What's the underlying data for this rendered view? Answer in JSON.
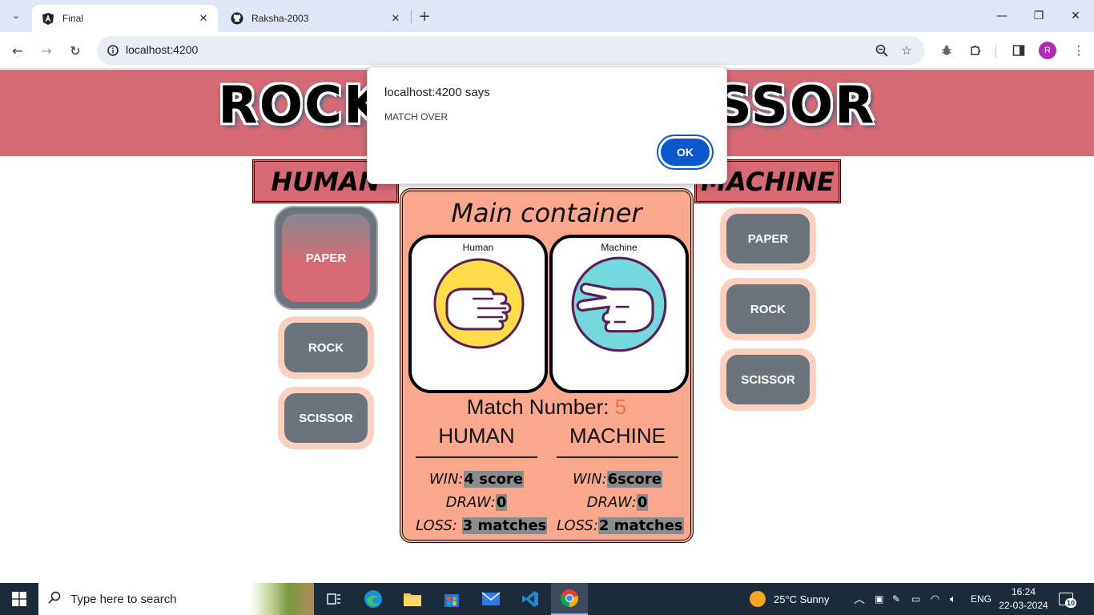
{
  "browser": {
    "tabs": [
      {
        "title": "Final",
        "icon": "angular-icon",
        "active": true
      },
      {
        "title": "Raksha-2003",
        "icon": "github-icon",
        "active": false
      }
    ],
    "url": "localhost:4200"
  },
  "page": {
    "banner_title": "ROCK PAPER SCISSOR",
    "human_header": "HUMAN",
    "machine_header": "MACHINE",
    "human_choices": [
      "PAPER",
      "ROCK",
      "SCISSOR"
    ],
    "machine_choices": [
      "PAPER",
      "ROCK",
      "SCISSOR"
    ],
    "main": {
      "title": "Main container",
      "human_card_label": "Human",
      "machine_card_label": "Machine",
      "match_label": "Match Number:",
      "match_number": "5",
      "human": {
        "title": "HUMAN",
        "win_label": "WIN:",
        "win_value": "4 score",
        "draw_label": "DRAW:",
        "draw_value": "0",
        "loss_label": "LOSS:",
        "loss_value": "3 matches"
      },
      "machine": {
        "title": "MACHINE",
        "win_label": "WIN:",
        "win_value": "6score",
        "draw_label": "DRAW:",
        "draw_value": "0",
        "loss_label": "LOSS:",
        "loss_value": "2 matches"
      }
    }
  },
  "dialog": {
    "title": "localhost:4200 says",
    "message": "MATCH OVER",
    "ok_label": "OK"
  },
  "taskbar": {
    "search_placeholder": "Type here to search",
    "weather": "25°C  Sunny",
    "language": "ENG",
    "time": "16:24",
    "date": "22-03-2024",
    "notifications": "10"
  },
  "colors": {
    "banner": "#d76b75",
    "main_bg": "#fca88c",
    "button_gray": "#6b737d",
    "button_border": "#fcd0bf",
    "dialog_ok": "#0b57d0",
    "match_number": "#e8743f",
    "human_hand_bg": "#fedc4a",
    "machine_hand_bg": "#74d8de"
  }
}
